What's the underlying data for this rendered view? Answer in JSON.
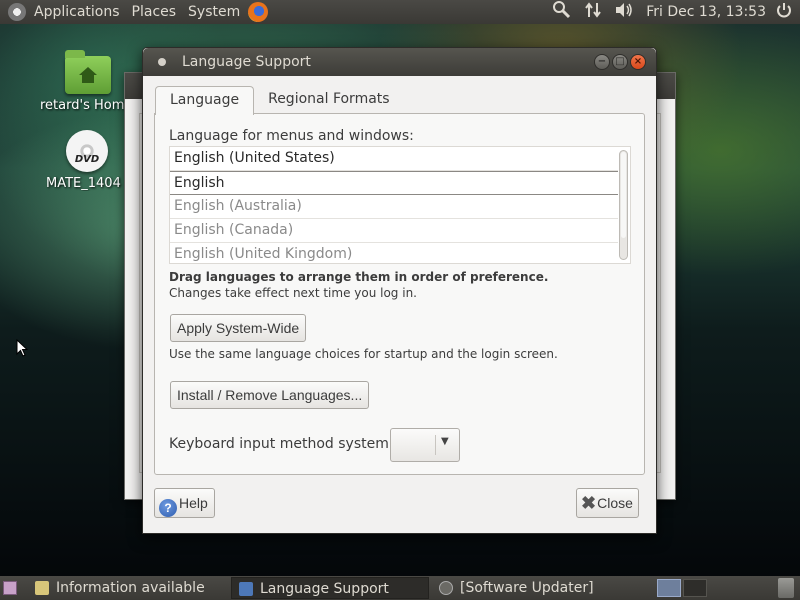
{
  "top_panel": {
    "menus": [
      "Applications",
      "Places",
      "System"
    ],
    "clock": "Fri Dec 13, 13:53"
  },
  "desktop": {
    "icons": [
      {
        "label": "retard's Home",
        "icon": "home-folder-icon"
      },
      {
        "label": "MATE_1404",
        "icon": "dvd-icon"
      }
    ]
  },
  "dialog": {
    "title": "Language Support",
    "tabs": [
      "Language",
      "Regional Formats"
    ],
    "active_tab": "Language",
    "language_heading": "Language for menus and windows:",
    "languages": [
      {
        "name": "English (United States)",
        "enabled": true
      },
      {
        "name": "English",
        "enabled": true
      },
      {
        "name": "English (Australia)",
        "enabled": false
      },
      {
        "name": "English (Canada)",
        "enabled": false
      },
      {
        "name": "English (United Kingdom)",
        "enabled": false
      }
    ],
    "drag_hint": "Drag languages to arrange them in order of preference.",
    "change_hint": "Changes take effect next time you log in.",
    "apply_button": "Apply System-Wide",
    "apply_hint": "Use the same language choices for startup and the login screen.",
    "install_button": "Install / Remove Languages...",
    "keyboard_label": "Keyboard input method system:",
    "keyboard_value": "",
    "help_button": "Help",
    "close_button": "Close"
  },
  "taskbar": {
    "tasks": [
      {
        "label": "Information available",
        "active": false
      },
      {
        "label": "Language Support",
        "active": true
      },
      {
        "label": "[Software Updater]",
        "active": false
      }
    ]
  }
}
